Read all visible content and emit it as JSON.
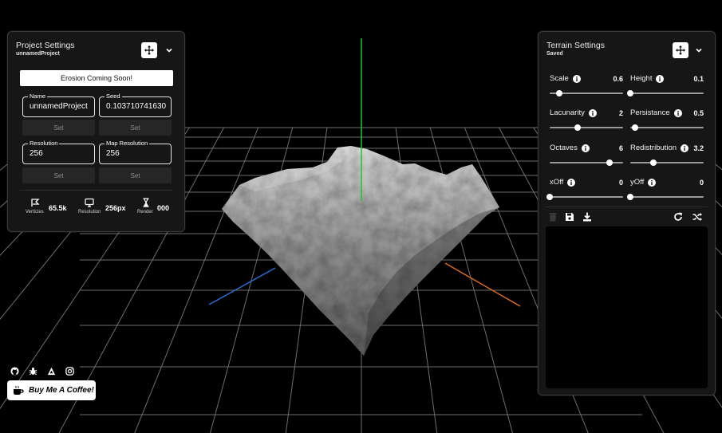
{
  "project_panel": {
    "title": "Project Settings",
    "subtitle": "unnamedProject",
    "erosion_button": "Erosion Coming Soon!",
    "fields": [
      {
        "label": "Name",
        "value": "unnamedProject"
      },
      {
        "label": "Seed",
        "value": "0.103710741630"
      },
      {
        "label": "Resolution",
        "value": "256"
      },
      {
        "label": "Map Resolution",
        "value": "256"
      }
    ],
    "set_label": "Set",
    "stats": [
      {
        "icon": "vertices-icon",
        "caption": "Verticies",
        "value": "65.5k"
      },
      {
        "icon": "monitor-icon",
        "caption": "Resolution",
        "value": "256px"
      },
      {
        "icon": "hourglass-icon",
        "caption": "Render",
        "value": "000"
      }
    ]
  },
  "terrain_panel": {
    "title": "Terrain Settings",
    "subtitle": "Saved",
    "sliders": [
      {
        "label": "Scale",
        "value": "0.6",
        "fraction": 0.13
      },
      {
        "label": "Height",
        "value": "0.1",
        "fraction": 0.0
      },
      {
        "label": "Lacunarity",
        "value": "2",
        "fraction": 0.38
      },
      {
        "label": "Persistance",
        "value": "0.5",
        "fraction": 0.07
      },
      {
        "label": "Octaves",
        "value": "6",
        "fraction": 0.82
      },
      {
        "label": "Redistribution",
        "value": "3.2",
        "fraction": 0.31
      },
      {
        "label": "xOff",
        "value": "0",
        "fraction": 0.0
      },
      {
        "label": "yOff",
        "value": "0",
        "fraction": 0.0
      }
    ]
  },
  "coffee_button": "Buy Me A Coffee!",
  "colors": {
    "panel_bg": "#161616",
    "panel_border": "#3a3a3a",
    "grid": "#7a7a7a",
    "axis_y": "#27c227",
    "axis_x": "#e06a1c",
    "axis_z": "#2a6fd6"
  }
}
